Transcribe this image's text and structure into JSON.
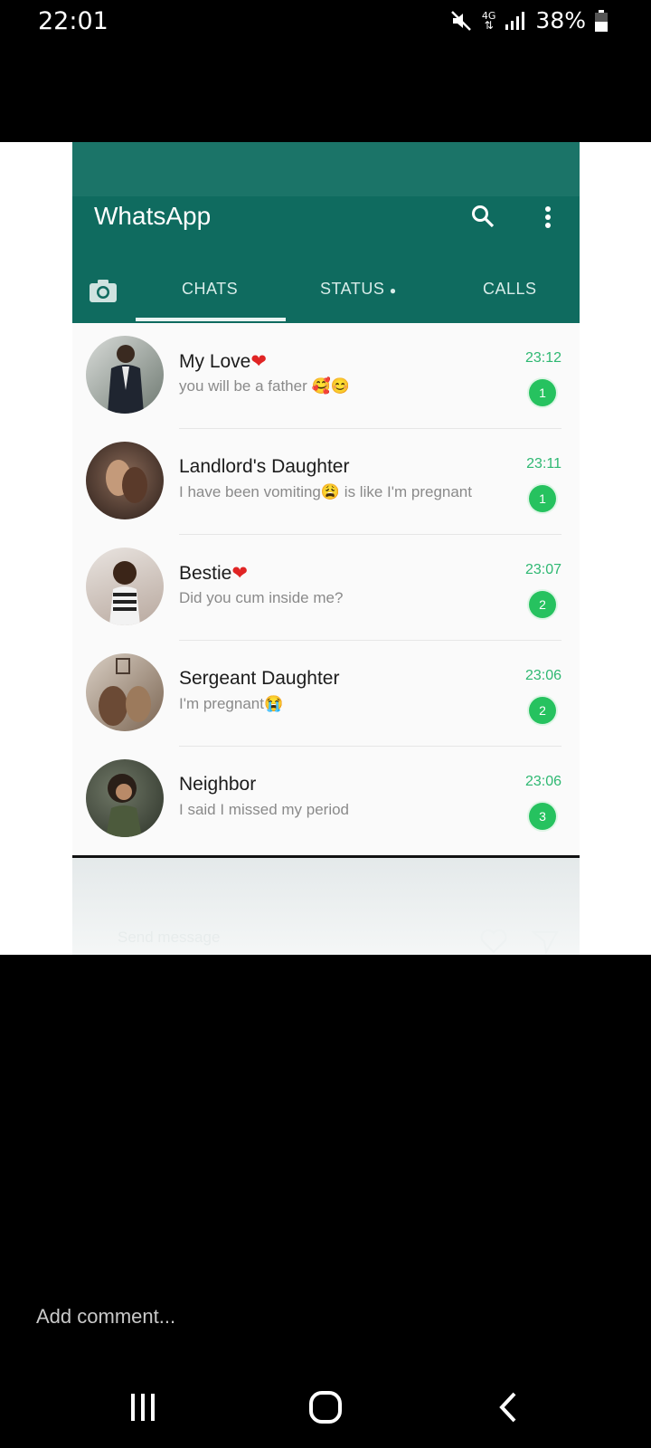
{
  "status_bar": {
    "time": "22:01",
    "network": "4G",
    "battery": "38%"
  },
  "whatsapp": {
    "title": "WhatsApp",
    "tabs": [
      "CHATS",
      "STATUS",
      "CALLS"
    ],
    "chats": [
      {
        "name": "My Love",
        "preview": "you will be a father",
        "time": "23:12",
        "unread": "1"
      },
      {
        "name": "Landlord's Daughter",
        "preview_before": "I have been vomiting",
        "preview_after": " is like I'm pregnant",
        "time": "23:11",
        "unread": "1"
      },
      {
        "name": "Bestie",
        "preview": "Did you cum inside me?",
        "time": "23:07",
        "unread": "2"
      },
      {
        "name": "Sergeant Daughter",
        "preview": "I'm pregnant",
        "time": "23:06",
        "unread": "2"
      },
      {
        "name": "Neighbor",
        "preview": "I said I missed my period",
        "time": "23:06",
        "unread": "3"
      }
    ],
    "send_message": "Send message"
  },
  "comment": {
    "placeholder": "Add comment..."
  },
  "colors": {
    "header": "#0f6b5f",
    "accent": "#26c25f",
    "heart": "#e02424"
  }
}
